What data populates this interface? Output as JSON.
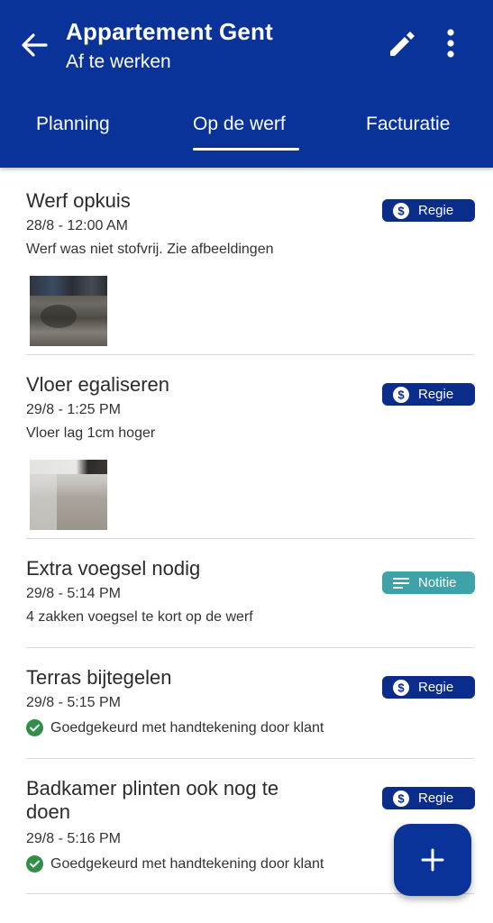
{
  "header": {
    "title": "Appartement Gent",
    "subtitle": "Af te werken",
    "back_icon": "arrow-back-icon",
    "edit_icon": "pencil-icon",
    "more_icon": "more-vert-icon",
    "background_color": "#0a339a"
  },
  "tabs": [
    {
      "label": "Planning",
      "selected": false
    },
    {
      "label": "Op de werf",
      "selected": true
    },
    {
      "label": "Facturatie",
      "selected": false
    }
  ],
  "items": [
    {
      "title": "Werf opkuis",
      "date": "28/8 - 12:00 AM",
      "description": "Werf was niet stofvrij. Zie afbeeldingen",
      "badge": "Regie",
      "badge_icon": "dollar-circle-icon",
      "has_image": true
    },
    {
      "title": "Vloer egaliseren",
      "date": "29/8 - 1:25 PM",
      "description": "Vloer lag 1cm hoger",
      "badge": "Regie",
      "badge_icon": "dollar-circle-icon",
      "has_image": true
    },
    {
      "title": "Extra voegsel nodig",
      "date": "29/8 - 5:14 PM",
      "description": "4 zakken voegsel te kort op de werf",
      "badge": "Notitie",
      "badge_icon": "notes-icon",
      "has_image": false
    },
    {
      "title": "Terras bijtegelen",
      "date": "29/8 - 5:15 PM",
      "approval": "Goedgekeurd met handtekening door klant",
      "badge": "Regie",
      "badge_icon": "dollar-circle-icon",
      "has_image": false
    },
    {
      "title_line1": "Badkamer plinten ook nog te",
      "title_line2": "doen",
      "date": "29/8 - 5:16 PM",
      "approval": "Goedgekeurd met handtekening door klant",
      "badge": "Regie",
      "badge_icon": "dollar-circle-icon",
      "has_image": false
    }
  ],
  "fab": {
    "icon": "plus-icon"
  },
  "colors": {
    "regie_badge": "#0a2c8a",
    "notitie_badge": "#3fa2a8",
    "approved_check": "#2f8f46"
  }
}
